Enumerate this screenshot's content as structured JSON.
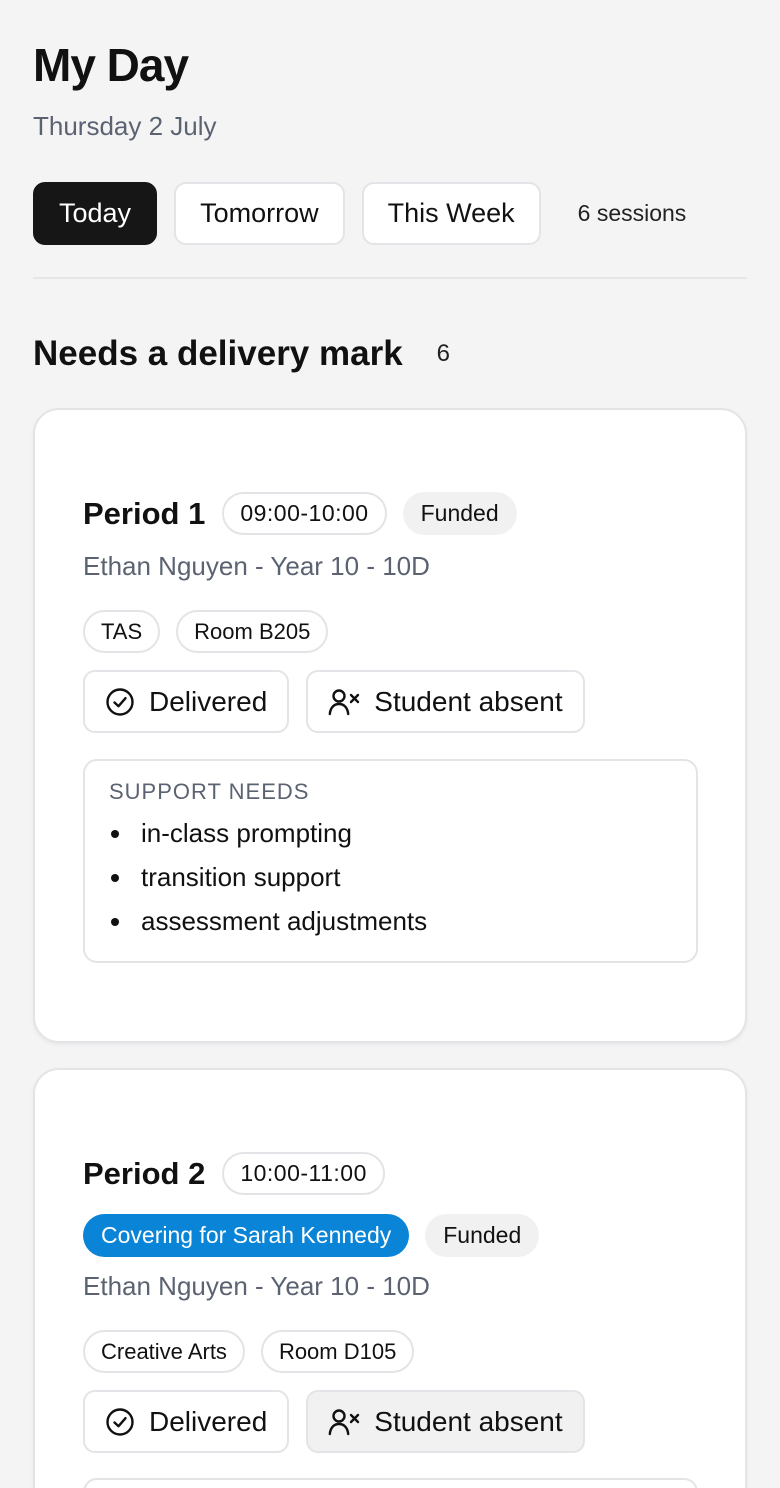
{
  "header": {
    "title": "My Day",
    "date": "Thursday 2 July"
  },
  "filters": {
    "today": "Today",
    "tomorrow": "Tomorrow",
    "this_week": "This Week",
    "active": "today",
    "session_count": "6 sessions"
  },
  "section": {
    "title": "Needs a delivery mark",
    "count": "6"
  },
  "sessions": [
    {
      "period": "Period 1",
      "time": "09:00-10:00",
      "funding": "Funded",
      "student": "Ethan Nguyen - Year 10 - 10D",
      "subject": "TAS",
      "room": "Room B205",
      "delivered_label": "Delivered",
      "absent_label": "Student absent",
      "needs_title": "SUPPORT NEEDS",
      "needs": [
        "in-class prompting",
        "transition support",
        "assessment adjustments"
      ]
    },
    {
      "period": "Period 2",
      "time": "10:00-11:00",
      "cover": "Covering for Sarah Kennedy",
      "funding": "Funded",
      "student": "Ethan Nguyen - Year 10 - 10D",
      "subject": "Creative Arts",
      "room": "Room D105",
      "delivered_label": "Delivered",
      "absent_label": "Student absent"
    }
  ],
  "colors": {
    "active_filter": "#161616",
    "cover_badge": "#0a84d6",
    "muted_text": "#5b6372"
  }
}
